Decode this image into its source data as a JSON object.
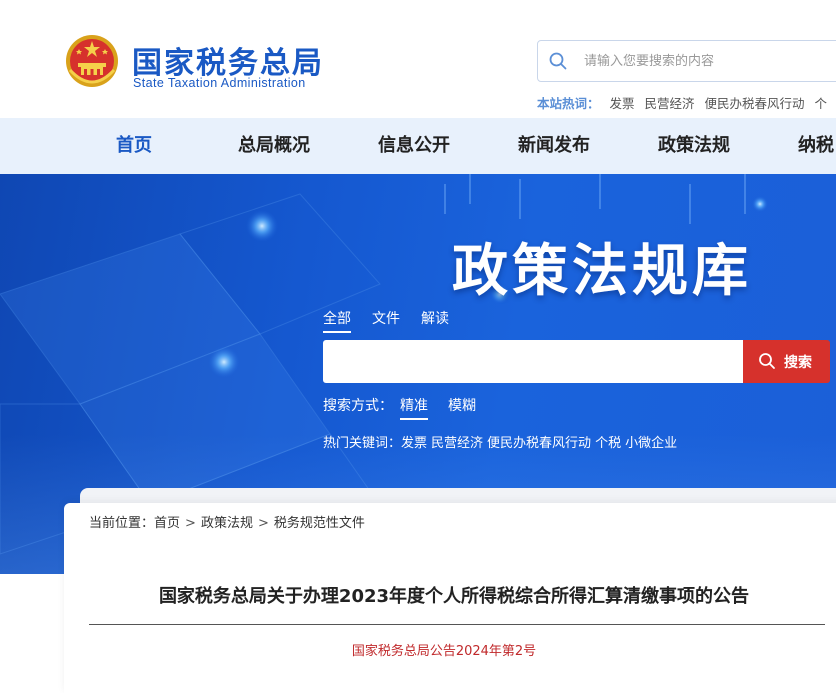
{
  "header": {
    "logo_cn": "国家税务总局",
    "logo_en": "State Taxation Administration",
    "search_placeholder": "请输入您要搜索的内容",
    "hot_label": "本站热词：",
    "hot_words": [
      "发票",
      "民营经济",
      "便民办税春风行动",
      "个"
    ]
  },
  "nav": {
    "items": [
      "首页",
      "总局概况",
      "信息公开",
      "新闻发布",
      "政策法规",
      "纳税"
    ],
    "active_index": 0
  },
  "banner": {
    "title": "政策法规库",
    "tabs": [
      "全部",
      "文件",
      "解读"
    ],
    "active_tab": 0,
    "search_button": "搜索",
    "mode_label": "搜索方式：",
    "mode_options": [
      "精准",
      "模糊"
    ],
    "active_mode": 0,
    "hot_keywords_label": "热门关键词：",
    "hot_keywords": [
      "发票",
      "民营经济",
      "便民办税春风行动",
      "个税",
      "小微企业"
    ]
  },
  "content": {
    "breadcrumb_label": "当前位置：",
    "breadcrumb": [
      "首页",
      "政策法规",
      "税务规范性文件"
    ],
    "breadcrumb_sep": ">",
    "title": "国家税务总局关于办理2023年度个人所得税综合所得汇算清缴事项的公告",
    "doc_number": "国家税务总局公告2024年第2号"
  },
  "colors": {
    "brand_blue": "#1a59c4",
    "nav_bg": "#e8f1fc",
    "search_button": "#d6312c",
    "doc_number": "#c0292b"
  }
}
